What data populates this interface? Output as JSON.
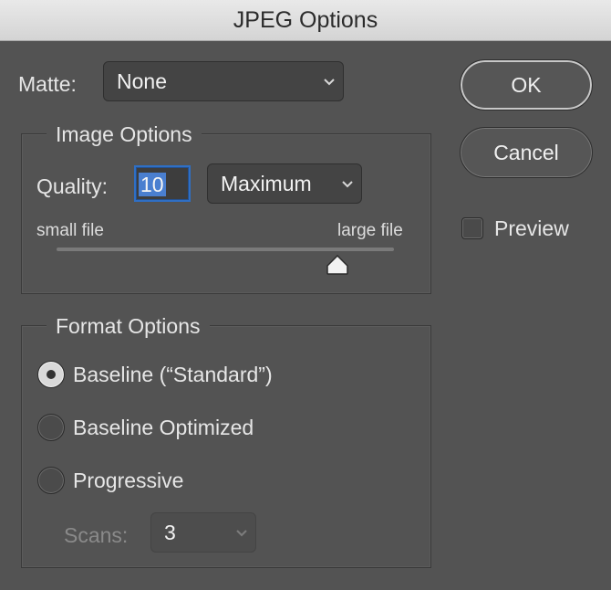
{
  "window": {
    "title": "JPEG Options"
  },
  "matte": {
    "label": "Matte:",
    "value": "None"
  },
  "image_options": {
    "legend": "Image Options",
    "quality_label": "Quality:",
    "quality_value": "10",
    "quality_preset": "Maximum",
    "slider_min_label": "small file",
    "slider_max_label": "large file",
    "slider_fraction": 0.833
  },
  "format_options": {
    "legend": "Format Options",
    "options": [
      {
        "label": "Baseline (“Standard”)",
        "checked": true
      },
      {
        "label": "Baseline Optimized",
        "checked": false
      },
      {
        "label": "Progressive",
        "checked": false
      }
    ],
    "scans_label": "Scans:",
    "scans_value": "3"
  },
  "buttons": {
    "ok": "OK",
    "cancel": "Cancel"
  },
  "preview": {
    "label": "Preview",
    "checked": false
  },
  "colors": {
    "background": "#535353",
    "focus_ring": "#2f6fc4",
    "selection": "#4a7fd0"
  }
}
